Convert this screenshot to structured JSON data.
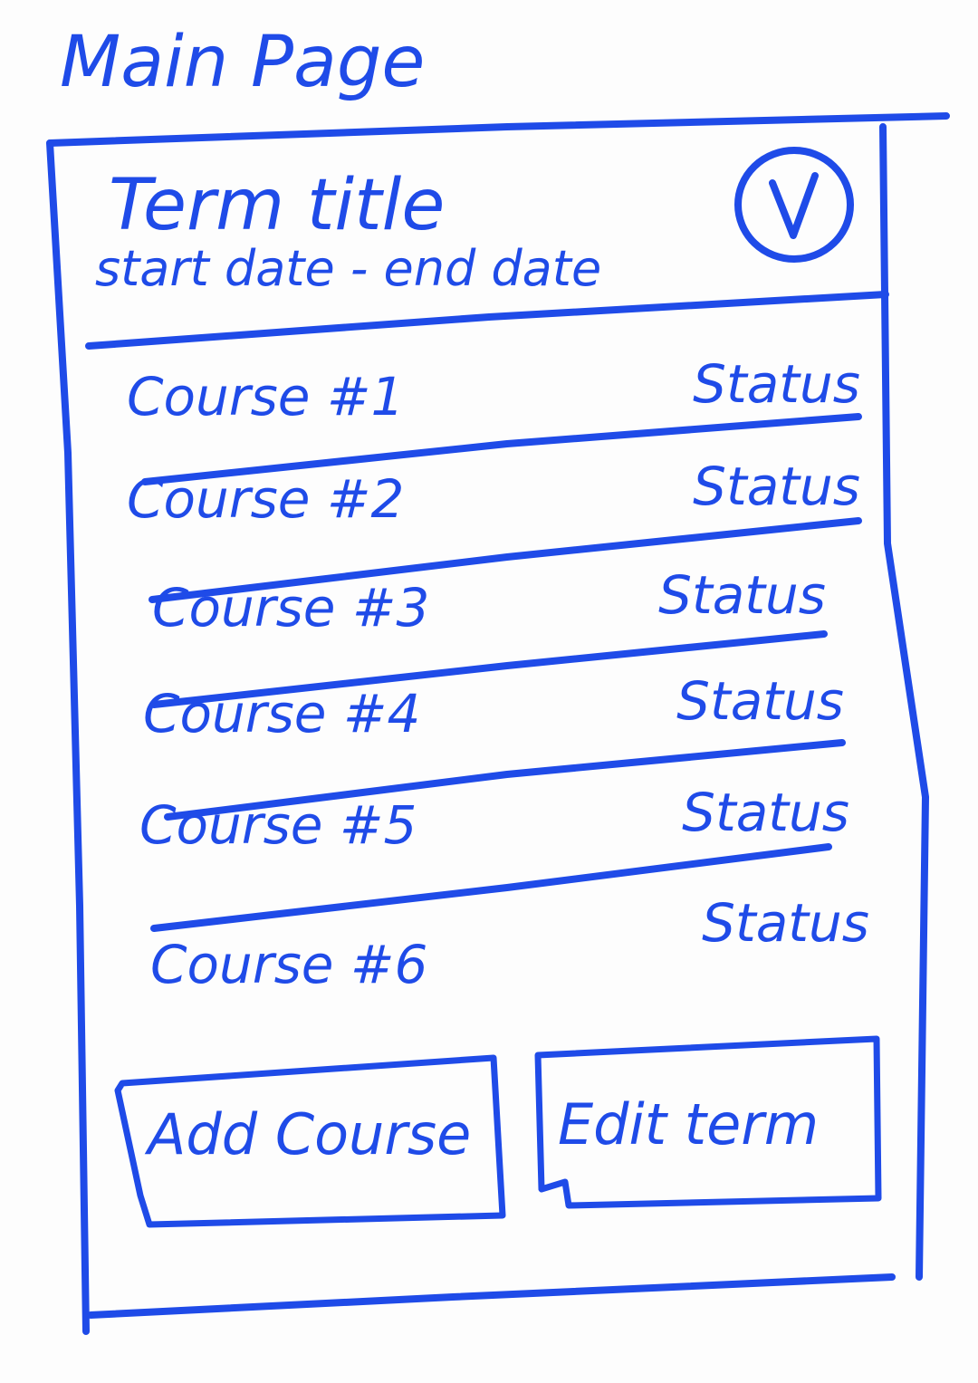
{
  "page": {
    "heading": "Main Page"
  },
  "term": {
    "title": "Term title",
    "dates": "start date - end date"
  },
  "courses": [
    {
      "name": "Course #1",
      "status": "Status"
    },
    {
      "name": "Course #2",
      "status": "Status"
    },
    {
      "name": "Course #3",
      "status": "Status"
    },
    {
      "name": "Course #4",
      "status": "Status"
    },
    {
      "name": "Course #5",
      "status": "Status"
    },
    {
      "name": "Course #6",
      "status": "Status"
    }
  ],
  "actions": {
    "add_course": "Add Course",
    "edit_term": "Edit term"
  },
  "icons": {
    "confirm": "check-icon"
  },
  "colors": {
    "ink": "#1f4be8",
    "paper": "#fdfdfd"
  }
}
